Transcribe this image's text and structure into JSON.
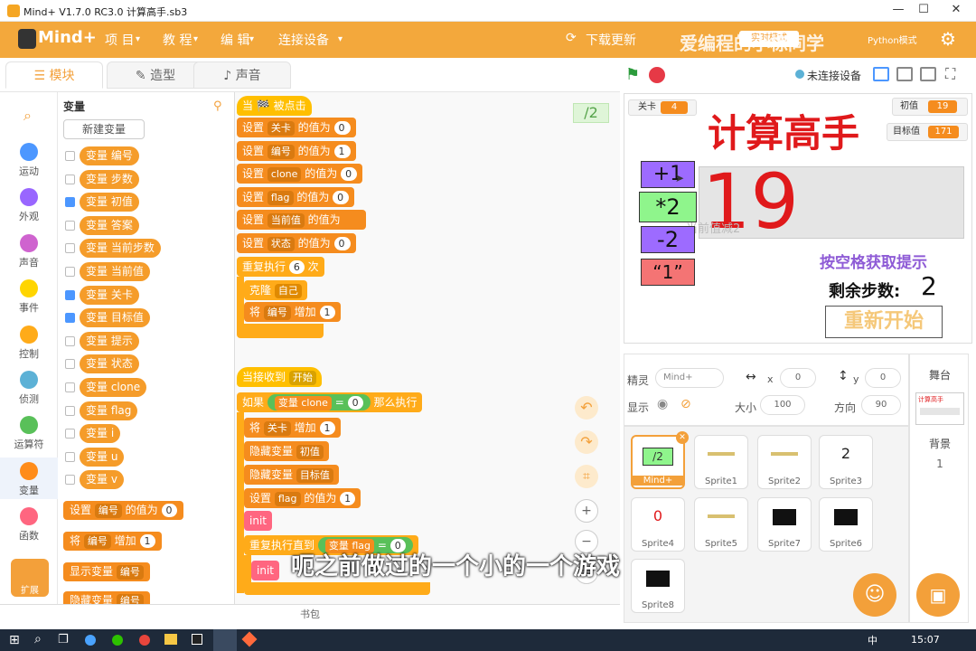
{
  "window": {
    "title": "Mind+ V1.7.0 RC3.0   计算高手.sb3",
    "min": "—",
    "max": "☐",
    "close": "✕"
  },
  "menu": {
    "logo": "Mind+",
    "items": [
      "项 目",
      "教 程",
      "编 辑",
      "连接设备"
    ],
    "download": "下载更新",
    "mode": "实时模式",
    "python": "Python模式"
  },
  "watermark": "爱编程的小棕同学",
  "tabs": [
    "模块",
    "造型",
    "声音"
  ],
  "stage_header": {
    "status": "未连接设备"
  },
  "categories": [
    {
      "label": "运动",
      "color": "#4c97ff"
    },
    {
      "label": "外观",
      "color": "#9966ff"
    },
    {
      "label": "声音",
      "color": "#cf63cf"
    },
    {
      "label": "事件",
      "color": "#ffd500"
    },
    {
      "label": "控制",
      "color": "#ffab19"
    },
    {
      "label": "侦测",
      "color": "#5cb1d6"
    },
    {
      "label": "运算符",
      "color": "#59c059"
    },
    {
      "label": "变量",
      "color": "#ff8c1a"
    },
    {
      "label": "函数",
      "color": "#ff6680"
    },
    {
      "label": "扩展",
      "color": "#f3a03a"
    }
  ],
  "palette": {
    "title": "变量",
    "new_var": "新建变量",
    "vars": [
      {
        "name": "变量 编号",
        "checked": false
      },
      {
        "name": "变量 步数",
        "checked": false
      },
      {
        "name": "变量 初值",
        "checked": true
      },
      {
        "name": "变量 答案",
        "checked": false
      },
      {
        "name": "变量 当前步数",
        "checked": false
      },
      {
        "name": "变量 当前值",
        "checked": false
      },
      {
        "name": "变量 关卡",
        "checked": true
      },
      {
        "name": "变量 目标值",
        "checked": true
      },
      {
        "name": "变量 提示",
        "checked": false
      },
      {
        "name": "变量 状态",
        "checked": false
      },
      {
        "name": "变量 clone",
        "checked": false
      },
      {
        "name": "变量 flag",
        "checked": false
      },
      {
        "name": "变量 i",
        "checked": false
      },
      {
        "name": "变量 u",
        "checked": false
      },
      {
        "name": "变量 v",
        "checked": false
      }
    ],
    "set_block": {
      "a": "设置",
      "var": "编号",
      "b": "的值为",
      "val": "0"
    },
    "change_block": {
      "a": "将",
      "var": "编号",
      "b": "增加",
      "val": "1"
    },
    "show_block": {
      "a": "显示变量",
      "var": "编号"
    },
    "hide_block": {
      "a": "隐藏变量",
      "var": "编号"
    }
  },
  "code": {
    "badge": "/2",
    "script1": {
      "hat": "当 🏁 被点击",
      "sets": [
        {
          "var": "关卡",
          "val": "0"
        },
        {
          "var": "编号",
          "val": "1"
        },
        {
          "var": "clone",
          "val": "0"
        },
        {
          "var": "flag",
          "val": "0"
        },
        {
          "var": "当前值",
          "val": ""
        },
        {
          "var": "状态",
          "val": "0"
        }
      ],
      "set_word": "设置",
      "of_word": "的值为",
      "repeat": "重复执行",
      "repeat_n": "6",
      "repeat_unit": "次",
      "clone": "克隆",
      "clone_target": "自己",
      "change": "将",
      "change_var": "编号",
      "change_word": "增加",
      "change_val": "1"
    },
    "script2": {
      "hat": "当接收到",
      "hat_msg": "开始",
      "if_word": "如果",
      "if_var": "变量 clone",
      "if_op": "=",
      "if_val": "0",
      "then_word": "那么执行",
      "change": "将",
      "change_var": "关卡",
      "change_word": "增加",
      "change_val": "1",
      "hide1": "隐藏变量",
      "hide1_var": "初值",
      "hide2": "隐藏变量",
      "hide2_var": "目标值",
      "set_word": "设置",
      "set_var": "flag",
      "of_word": "的值为",
      "set_val": "1",
      "init": "init",
      "until": "重复执行直到",
      "until_var": "变量 flag",
      "until_op": "=",
      "until_val": "0",
      "init2": "init"
    },
    "bag": "书包"
  },
  "stage": {
    "level_label": "关卡",
    "level_val": "4",
    "title": "计算高手",
    "init_label": "初值",
    "init_val": "19",
    "target_label": "目标值",
    "target_val": "171",
    "ops": [
      "+1",
      "*2",
      "-2",
      "“1”"
    ],
    "big_num": "19",
    "hint_gray": "当前值减2",
    "hint": "按空格获取提示",
    "remaining_label": "剩余步数:",
    "remaining_val": "2",
    "restart": "重新开始"
  },
  "sprite_info": {
    "sprite_label": "精灵",
    "sprite_name": "Mind+",
    "x_label": "x",
    "x_val": "0",
    "y_label": "y",
    "y_val": "0",
    "show_label": "显示",
    "size_label": "大小",
    "size_val": "100",
    "dir_label": "方向",
    "dir_val": "90"
  },
  "sprites": [
    {
      "name": "Mind+",
      "thumb": "/2"
    },
    {
      "name": "Sprite1",
      "thumb": ""
    },
    {
      "name": "Sprite2",
      "thumb": ""
    },
    {
      "name": "Sprite3",
      "thumb": "2"
    },
    {
      "name": "Sprite4",
      "thumb": "0"
    },
    {
      "name": "Sprite5",
      "thumb": ""
    },
    {
      "name": "Sprite7",
      "thumb": ""
    },
    {
      "name": "Sprite6",
      "thumb": ""
    },
    {
      "name": "Sprite8",
      "thumb": ""
    }
  ],
  "stage_panel": {
    "label": "舞台",
    "thumb_title": "计算高手",
    "bg_label": "背景",
    "bg_count": "1"
  },
  "subtitle": "呃之前做过的一个小的一个游戏",
  "taskbar": {
    "ime": "中",
    "time": "15:07"
  }
}
